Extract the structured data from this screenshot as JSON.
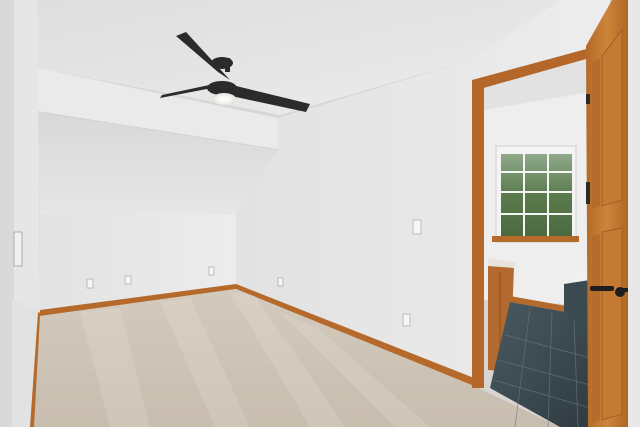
{
  "scene": {
    "colors": {
      "ceiling": "#e7e7e7",
      "wall_left": "#e5e5e5",
      "wall_back": "#e9e9e9",
      "wall_right": "#e4e4e4",
      "carpet": "#cdc3b6",
      "trim": "#b56a2c",
      "door": "#c2772f",
      "tile": "#3d4b52",
      "window_glass": "#5f7f54",
      "fan": "#2b2b2b"
    },
    "icons": {
      "fan": "ceiling-fan-icon",
      "door_handle": "door-lever-icon"
    }
  }
}
